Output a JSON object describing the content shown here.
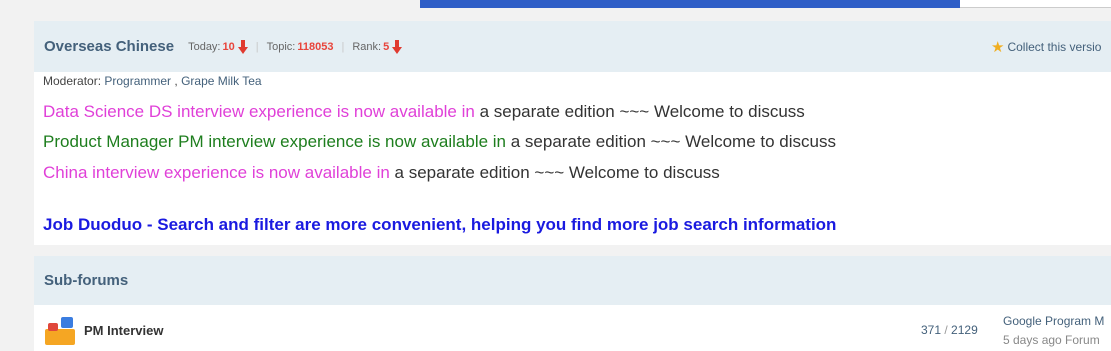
{
  "forum": {
    "title": "Overseas Chinese",
    "today_label": "Today:",
    "today_value": "10",
    "topic_label": "Topic:",
    "topic_value": "118053",
    "rank_label": "Rank:",
    "rank_value": "5",
    "collect_label": "Collect this versio"
  },
  "moderator": {
    "label": "Moderator:",
    "names": [
      "Programmer",
      "Grape Milk Tea"
    ]
  },
  "notices": [
    {
      "highlight": "Data Science DS interview experience is now available in",
      "rest": " a separate edition ~~~ Welcome to discuss"
    },
    {
      "highlight": "Product Manager PM interview experience is now available in",
      "rest": " a separate edition ~~~ Welcome to discuss"
    },
    {
      "highlight": "China interview experience is now available in",
      "rest": " a separate edition ~~~ Welcome to discuss"
    }
  ],
  "job_link": "Job Duoduo - Search and filter are more convenient, helping you find more job search information",
  "subforums": {
    "header": "Sub-forums",
    "items": [
      {
        "name": "PM Interview",
        "topics": "371",
        "posts": "2129",
        "last_post": "Google Program M",
        "last_time": "5 days ago Forum"
      }
    ]
  },
  "colors": {
    "header_bg": "#e5eef3",
    "title": "#44617b",
    "stat_red": "#e8453c",
    "magenta": "#e040d8",
    "green": "#1e7e1e",
    "job_blue": "#1a1ae0"
  }
}
